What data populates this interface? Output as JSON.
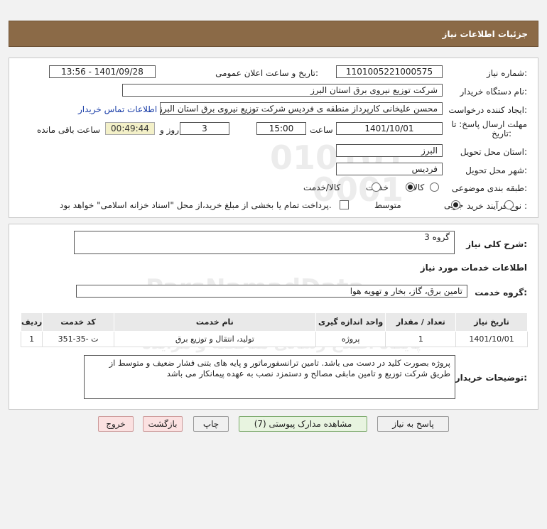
{
  "header": {
    "title": "جزئیات اطلاعات نیاز"
  },
  "form": {
    "need_number_label": "شماره نیاز:",
    "need_number": "1101005221000575",
    "announce_label": "تاریخ و ساعت اعلان عمومی:",
    "announce_value": "1401/09/28 - 13:56",
    "buyer_label": "نام دستگاه خریدار:",
    "buyer_value": "شرکت توزیع نیروی برق استان البرز",
    "creator_label": "ایجاد کننده درخواست:",
    "creator_value": "محسن علیخانی کارپرداز منطقه ی فردیس شرکت توزیع نیروی برق استان البرز",
    "contact_link": "اطلاعات تماس خریدار",
    "deadline_label_1": "مهلت ارسال پاسخ: تا",
    "deadline_label_2": "تاریخ:",
    "deadline_date": "1401/10/01",
    "time_label": "ساعت",
    "deadline_time": "15:00",
    "days_value": "3",
    "days_label": "روز و",
    "remaining_time": "00:49:44",
    "remaining_label": "ساعت باقی مانده",
    "province_label": "استان محل تحویل:",
    "province_value": "البرز",
    "city_label": "شهر محل تحویل:",
    "city_value": "فردیس",
    "category_label": "طبقه بندی موضوعی:",
    "category_options": [
      "کالا",
      "خدمت",
      "کالا/خدمت"
    ],
    "category_selected": "خدمت",
    "purchase_type_label": "نوع فرآیند خرید :",
    "purchase_options": [
      "جزیی",
      "متوسط"
    ],
    "purchase_selected": "متوسط",
    "treasury_note": "پرداخت تمام یا بخشی از مبلغ خرید،از محل \"اسناد خزانه اسلامی\" خواهد بود."
  },
  "details": {
    "summary_label": "شرح کلی نیاز:",
    "summary_value": "گروه 3",
    "services_title": "اطلاعات خدمات مورد نیاز",
    "service_group_label": "گروه خدمت:",
    "service_group_value": "تامین برق، گاز، بخار و تهویه هوا",
    "table": {
      "headers": [
        "ردیف",
        "کد خدمت",
        "نام خدمت",
        "واحد اندازه گیری",
        "تعداد / مقدار",
        "تاریخ نیاز"
      ],
      "rows": [
        [
          "1",
          "ت -35-351",
          "تولید، انتقال و توزیع برق",
          "پروژه",
          "1",
          "1401/10/01"
        ]
      ]
    },
    "buyer_notes_label": "توضیحات خریدار:",
    "buyer_notes": "پروژه بصورت کلید در دست می باشد. تامین ترانسفورماتور و پایه های بتنی فشار ضعیف و متوسط از طریق شرکت توزیع و تامین مابقی مصالح و دستمزد نصب به عهده پیمانکار می باشد"
  },
  "buttons": {
    "reply": "پاسخ به نیاز",
    "attachments": "مشاهده مدارک پیوستی (7)",
    "print": "چاپ",
    "back": "بازگشت",
    "exit": "خروج"
  },
  "watermark": {
    "digits_1": "010101",
    "digits_2": "0001",
    "brand": "ParsNamadData",
    "slogan_1": "مرکز فراخوان اطلاعات مناقصه و مزایده ها",
    "slogan_2": "پایگاه اطلاع رسانی مناقصه و مزایده"
  }
}
